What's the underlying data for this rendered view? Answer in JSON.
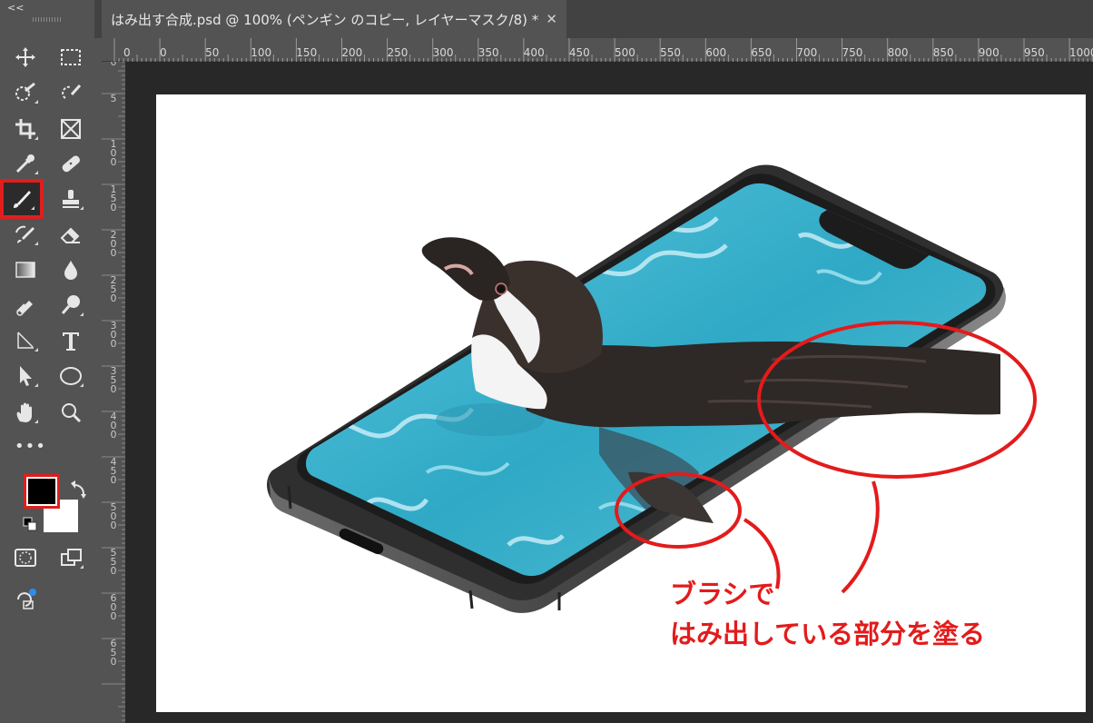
{
  "toolbar": {
    "collapse_icon": "double-chevron-left-icon",
    "tools": [
      "move-tool",
      "marquee-tool",
      "quick-selection-tool",
      "lasso-tool",
      "crop-tool",
      "frame-tool",
      "eyedropper-tool",
      "healing-brush-tool",
      "brush-tool",
      "clone-stamp-tool",
      "history-brush-tool",
      "eraser-tool",
      "gradient-tool",
      "blur-tool",
      "burn-tool",
      "dodge-tool",
      "pen-tool",
      "type-tool",
      "path-selection-tool",
      "ellipse-tool",
      "hand-tool",
      "zoom-tool"
    ],
    "more_label": "•••",
    "foreground_color": "#000000",
    "background_color": "#ffffff",
    "highlight_color": "#e01e1e"
  },
  "tab": {
    "title": "はみ出す合成.psd @ 100% (ペンギン のコピー, レイヤーマスク/8) *",
    "close_label": "✕"
  },
  "ruler": {
    "horizontal": [
      "0",
      "0",
      "50",
      "100",
      "150",
      "200",
      "250",
      "300",
      "350",
      "400",
      "450",
      "500",
      "550",
      "600",
      "650",
      "700",
      "750",
      "800",
      "850",
      "900",
      "950",
      "1000"
    ],
    "vertical": [
      "0",
      "5",
      "1\n0\n0",
      "1\n5\n0",
      "2\n0\n0",
      "2\n5\n0",
      "3\n0\n0",
      "3\n5\n0",
      "4\n0\n0",
      "4\n5\n0",
      "5\n0\n0",
      "5\n5\n0",
      "6\n0\n0",
      "6\n5\n0"
    ]
  },
  "annotation": {
    "line1": "ブラシで",
    "line2": "はみ出している部分を塗る",
    "color": "#e31b1b"
  }
}
